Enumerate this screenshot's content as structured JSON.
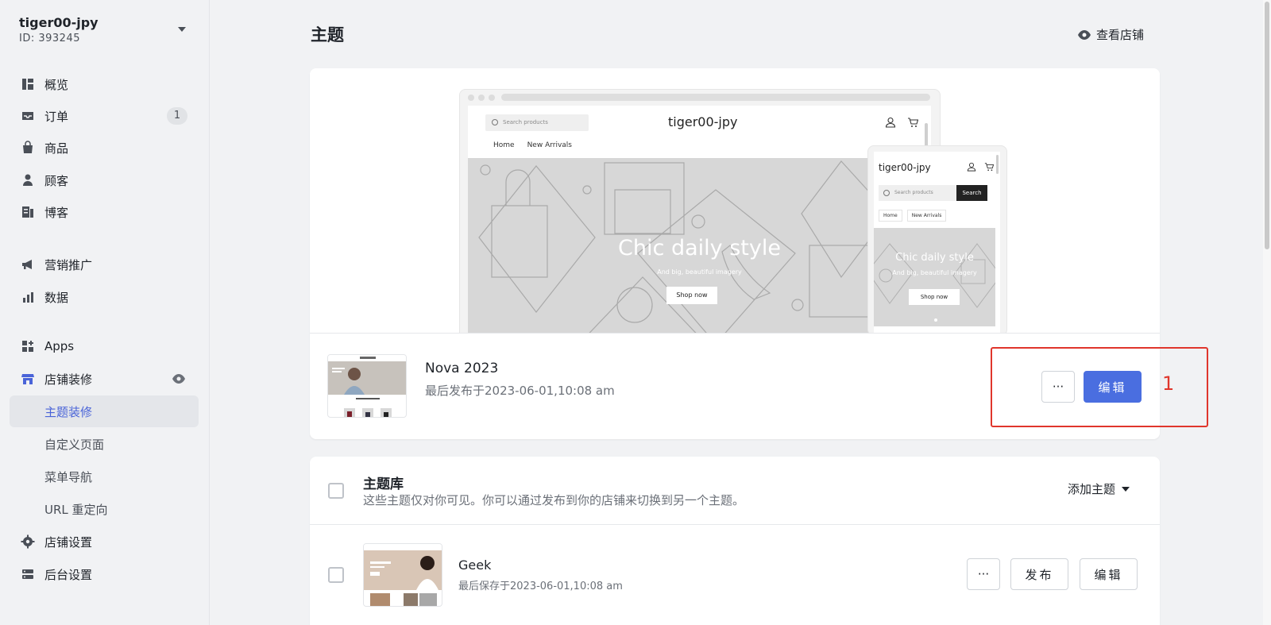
{
  "store": {
    "name": "tiger00-jpy",
    "id": "ID: 393245"
  },
  "sidebar": {
    "items": [
      {
        "label": "概览",
        "icon": "dashboard-icon"
      },
      {
        "label": "订单",
        "icon": "inbox-icon",
        "badge": "1"
      },
      {
        "label": "商品",
        "icon": "bag-icon"
      },
      {
        "label": "顾客",
        "icon": "person-icon"
      },
      {
        "label": "博客",
        "icon": "blog-icon"
      },
      {
        "label": "营销推广",
        "icon": "megaphone-icon"
      },
      {
        "label": "数据",
        "icon": "bar-chart-icon"
      },
      {
        "label": "Apps",
        "icon": "apps-icon"
      },
      {
        "label": "店铺装修",
        "icon": "store-icon"
      },
      {
        "label": "店铺设置",
        "icon": "gear-icon"
      },
      {
        "label": "后台设置",
        "icon": "server-icon"
      }
    ],
    "sub_items": [
      {
        "label": "主题装修",
        "active": true
      },
      {
        "label": "自定义页面"
      },
      {
        "label": "菜单导航"
      },
      {
        "label": "URL 重定向"
      }
    ]
  },
  "header": {
    "title": "主题",
    "view_store": "查看店铺"
  },
  "preview": {
    "desktop": {
      "search_placeholder": "Search products",
      "logo": "tiger00-jpy",
      "nav": [
        "Home",
        "New Arrivals"
      ],
      "hero_title": "Chic daily style",
      "hero_subtitle": "And big, beautiful imagery",
      "hero_button": "Shop now"
    },
    "mobile": {
      "logo": "tiger00-jpy",
      "search_placeholder": "Search products",
      "search_button": "Search",
      "nav": [
        "Home",
        "New Arrivals"
      ],
      "hero_title": "Chic daily style",
      "hero_subtitle": "And big, beautiful imagery",
      "hero_button": "Shop now"
    }
  },
  "current_theme": {
    "name": "Nova 2023",
    "meta": "最后发布于2023-06-01,10:08 am",
    "more_label": "···",
    "edit_label": "编辑"
  },
  "annotation": {
    "number": "1",
    "color": "#e0362c"
  },
  "library": {
    "title": "主题库",
    "description": "这些主题仅对你可见。你可以通过发布到你的店铺来切换到另一个主题。",
    "add_theme": "添加主题",
    "themes": [
      {
        "name": "Geek",
        "meta": "最后保存于2023-06-01,10:08 am",
        "more_label": "···",
        "publish_label": "发布",
        "edit_label": "编辑"
      }
    ]
  },
  "colors": {
    "accent": "#4a6ee0",
    "active_nav_text": "#4a64d8",
    "background": "#f1f2f4"
  }
}
